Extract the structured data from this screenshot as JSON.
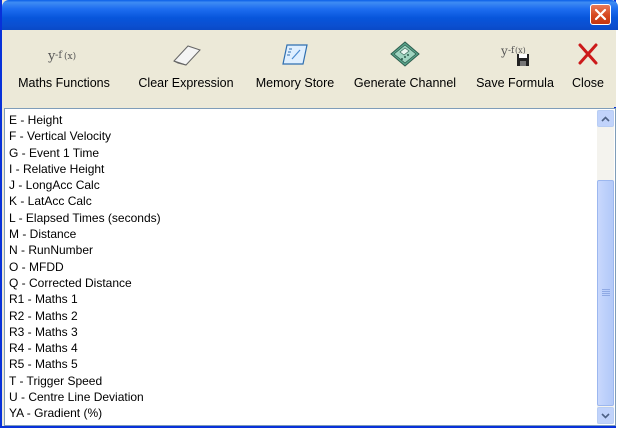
{
  "toolbar": {
    "buttons": [
      {
        "label": "Maths Functions",
        "icon": "maths-function-icon"
      },
      {
        "label": "Clear Expression",
        "icon": "eraser-icon"
      },
      {
        "label": "Memory Store",
        "icon": "memory-store-icon"
      },
      {
        "label": "Generate Channel",
        "icon": "calculator-icon"
      },
      {
        "label": "Save Formula",
        "icon": "save-formula-icon"
      },
      {
        "label": "Close",
        "icon": "close-red-x-icon"
      }
    ]
  },
  "channels": [
    "E - Height",
    "F - Vertical Velocity",
    "G - Event 1 Time",
    "I - Relative Height",
    "J - LongAcc Calc",
    "K - LatAcc Calc",
    "L - Elapsed Times (seconds)",
    "M - Distance",
    "N - RunNumber",
    "O - MFDD",
    "Q - Corrected Distance",
    "R1 - Maths 1",
    "R2 - Maths 2",
    "R3 - Maths 3",
    "R4 - Maths 4",
    "R5 - Maths 5",
    "T - Trigger Speed",
    "U - Centre Line Deviation",
    "YA - Gradient (%)"
  ],
  "colors": {
    "titlebar": "#0a55dc",
    "close_button": "#d6481f",
    "toolbar_bg": "#ece9d8",
    "scrollbar": "#c1d3fb"
  }
}
